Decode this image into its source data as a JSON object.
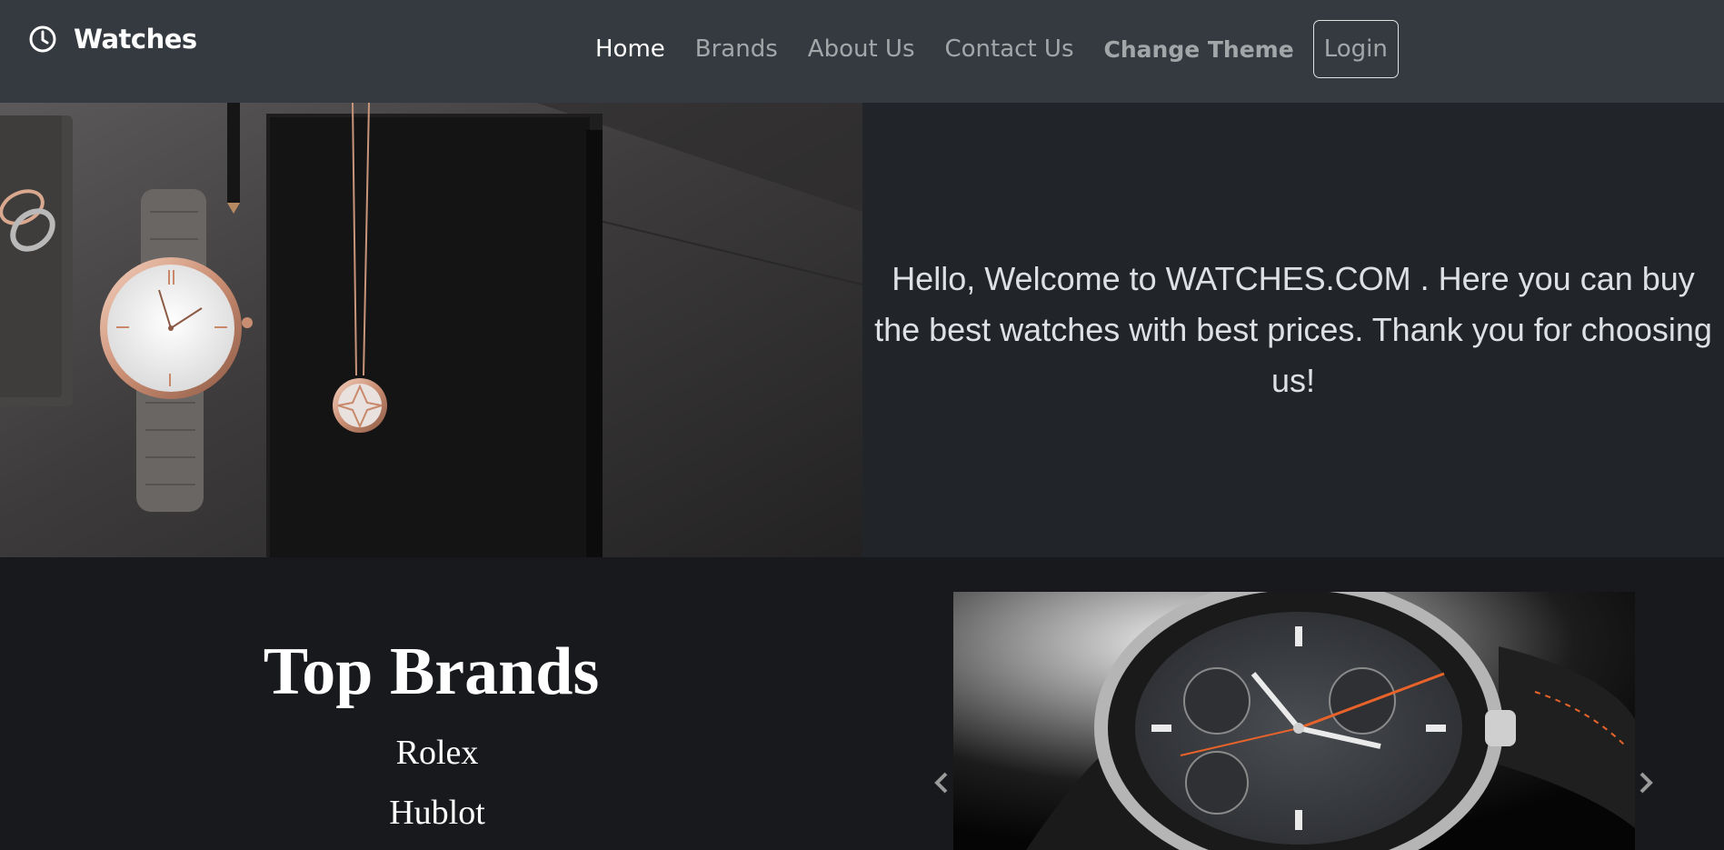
{
  "navbar": {
    "brand_icon": "clock-icon",
    "brand_name": "Watches",
    "links": [
      {
        "label": "Home",
        "active": true
      },
      {
        "label": "Brands",
        "active": false
      },
      {
        "label": "About Us",
        "active": false
      },
      {
        "label": "Contact Us",
        "active": false
      }
    ],
    "change_theme_label": "Change Theme",
    "login_label": "Login"
  },
  "hero": {
    "image_alt": "Rose gold watch with white dial and pendant on dark slate surface",
    "welcome_text": "Hello, Welcome to WATCHES.COM . Here you can buy the best watches with best prices. Thank you for choosing us!"
  },
  "top_brands": {
    "title": "Top Brands",
    "items": [
      "Rolex",
      "Hublot"
    ]
  },
  "carousel": {
    "image_alt": "Chronograph watch with tachymeter bezel and orange accents",
    "prev_icon": "chevron-left-icon",
    "next_icon": "chevron-right-icon"
  },
  "colors": {
    "navbar_bg": "#343a40",
    "hero_text_bg": "#212529",
    "page_bg": "#18191d",
    "accent_orange": "#e8632a"
  }
}
